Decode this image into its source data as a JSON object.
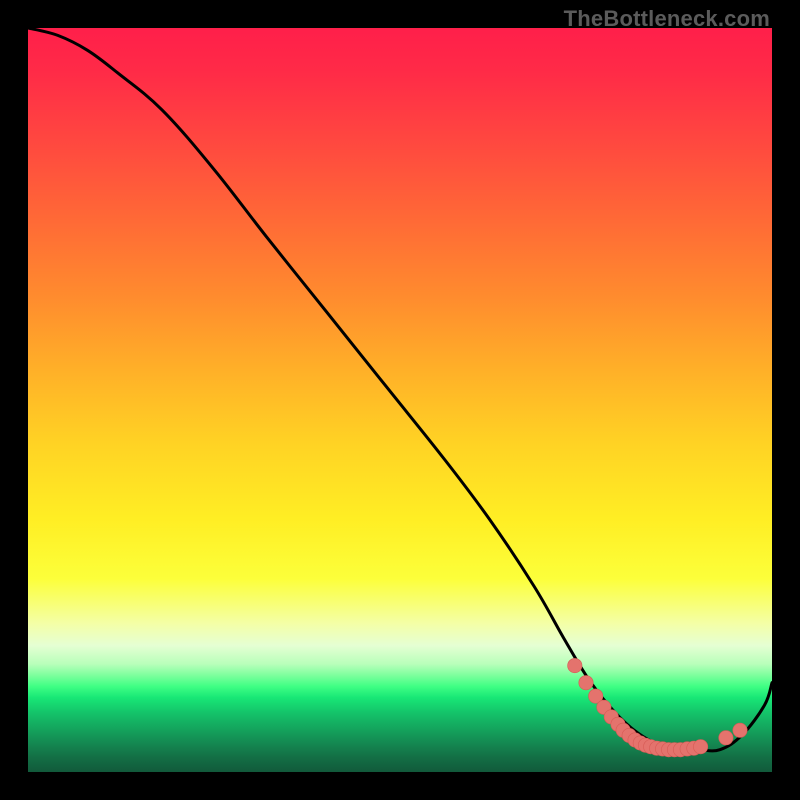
{
  "watermark": "TheBottleneck.com",
  "colors": {
    "curve_stroke": "#000000",
    "marker_fill": "#e4736d",
    "marker_stroke": "#d65b55"
  },
  "chart_data": {
    "type": "line",
    "title": "",
    "xlabel": "",
    "ylabel": "",
    "xlim": [
      0,
      100
    ],
    "ylim": [
      0,
      100
    ],
    "grid": false,
    "legend": false,
    "series": [
      {
        "name": "curve",
        "x": [
          0,
          4,
          8,
          12,
          18,
          25,
          32,
          40,
          48,
          56,
          62,
          68,
          72,
          75,
          78,
          81,
          84,
          87,
          90,
          93,
          96,
          99,
          100
        ],
        "y": [
          100,
          99,
          97,
          94,
          89,
          81,
          72,
          62,
          52,
          42,
          34,
          25,
          18,
          13,
          9,
          6,
          4,
          3,
          3,
          3,
          5,
          9,
          12
        ]
      }
    ],
    "markers": {
      "name": "highlight",
      "x": [
        73.5,
        75.0,
        76.3,
        77.4,
        78.4,
        79.3,
        80.0,
        80.8,
        81.6,
        82.3,
        83.0,
        83.7,
        84.5,
        85.3,
        86.1,
        86.9,
        87.7,
        88.6,
        89.5,
        90.4,
        93.8,
        95.7
      ],
      "y": [
        14.3,
        12.0,
        10.2,
        8.7,
        7.4,
        6.4,
        5.6,
        4.9,
        4.3,
        3.9,
        3.6,
        3.4,
        3.2,
        3.1,
        3.0,
        3.0,
        3.0,
        3.1,
        3.2,
        3.4,
        4.6,
        5.6
      ]
    }
  }
}
